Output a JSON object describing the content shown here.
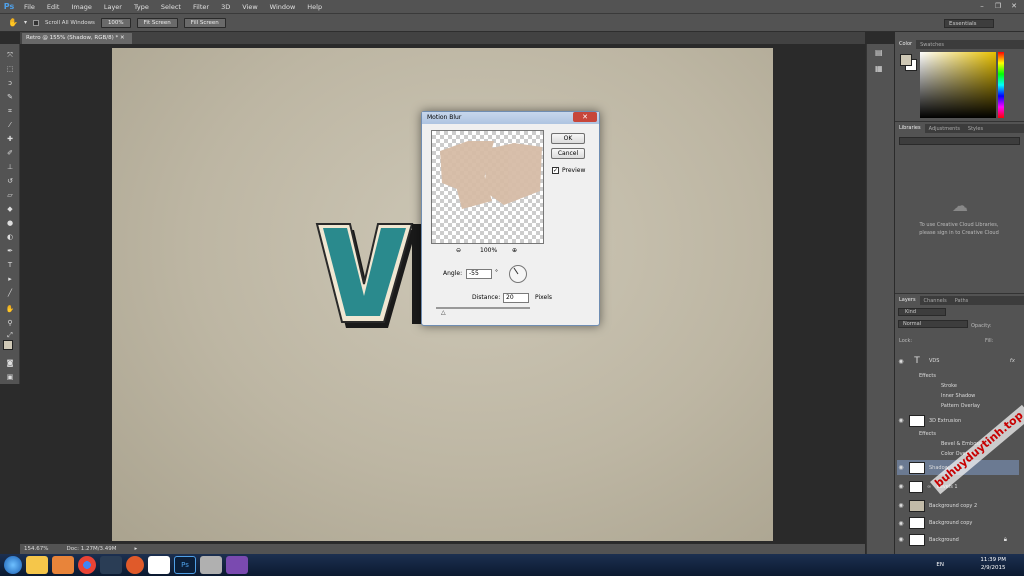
{
  "app": {
    "logo": "Ps"
  },
  "menu": [
    "File",
    "Edit",
    "Image",
    "Layer",
    "Type",
    "Select",
    "Filter",
    "3D",
    "View",
    "Window",
    "Help"
  ],
  "options_bar": {
    "scroll_all_windows": "Scroll All Windows",
    "zoom_100": "100%",
    "fit_screen": "Fit Screen",
    "fill_screen": "Fill Screen",
    "workspace": "Essentials"
  },
  "document": {
    "tab_title": "Retro @ 155% (Shadow, RGB/8) *"
  },
  "status_bar": {
    "zoom": "154.67%",
    "doc_size": "Doc: 1.27M/3.49M"
  },
  "color_panel": {
    "tabs": [
      "Color",
      "Swatches"
    ],
    "colors": {
      "foreground": "#cfc8b5",
      "background": "#ffffff"
    }
  },
  "libraries_panel": {
    "tabs": [
      "Libraries",
      "Adjustments",
      "Styles"
    ],
    "message_line1": "To use Creative Cloud Libraries,",
    "message_line2": "please sign in to Creative Cloud"
  },
  "layers_panel": {
    "tabs": [
      "Layers",
      "Channels",
      "Paths"
    ],
    "filter": "Kind",
    "blend_mode": "Normal",
    "opacity_label": "Opacity:",
    "lock_label": "Lock:",
    "fill_label": "Fill:",
    "layers": [
      {
        "name": "VDS",
        "fx": "fx",
        "effects_label": "Effects",
        "effects": [
          "Stroke",
          "Inner Shadow",
          "Pattern Overlay"
        ]
      },
      {
        "name": "3D Extrusion",
        "fx": "fx",
        "effects_label": "Effects",
        "effects": [
          "Bevel & Emboss",
          "Color Overlay"
        ]
      },
      {
        "name": "Shadow"
      },
      {
        "name": "Levels 1"
      },
      {
        "name": "Background copy 2"
      },
      {
        "name": "Background copy"
      },
      {
        "name": "Background"
      }
    ]
  },
  "motion_blur_dialog": {
    "title": "Motion Blur",
    "ok": "OK",
    "cancel": "Cancel",
    "preview_label": "Preview",
    "preview_checked": true,
    "zoom": "100%",
    "angle_label": "Angle:",
    "angle_value": "-55",
    "angle_unit": "°",
    "distance_label": "Distance:",
    "distance_value": "20",
    "distance_unit": "Pixels"
  },
  "taskbar": {
    "language": "EN",
    "time": "11:39 PM",
    "date": "2/9/2015"
  },
  "watermark": "buhuyduytinh.top"
}
